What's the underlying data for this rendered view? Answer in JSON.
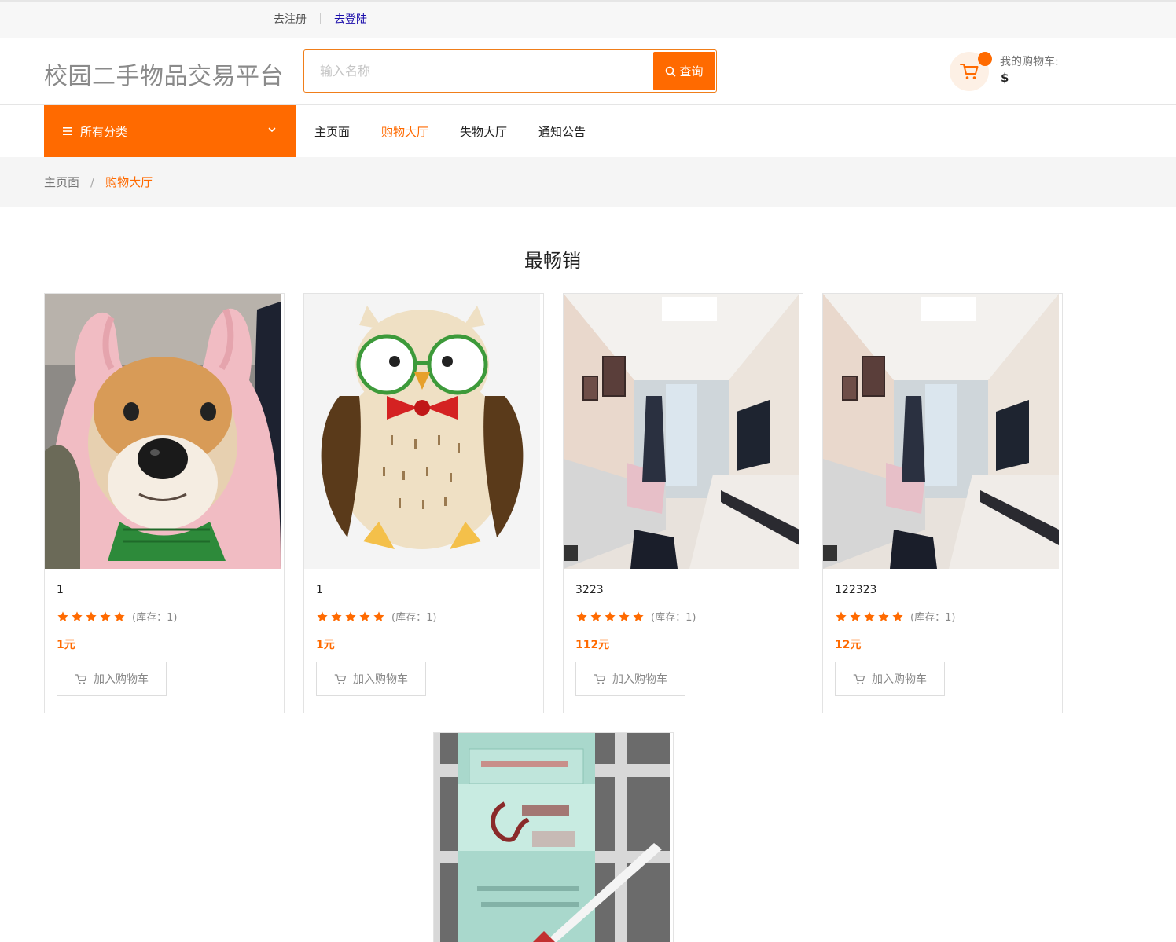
{
  "topbar": {
    "register": "去注册",
    "login": "去登陆"
  },
  "header": {
    "logo": "校园二手物品交易平台",
    "search_placeholder": "输入名称",
    "search_button": "查询",
    "cart_label": "我的购物车:",
    "cart_value": "$"
  },
  "nav": {
    "categories": "所有分类",
    "items": [
      "主页面",
      "购物大厅",
      "失物大厅",
      "通知公告"
    ],
    "active": "购物大厅"
  },
  "breadcrumb": {
    "home": "主页面",
    "separator": "/",
    "current": "购物大厅"
  },
  "section_title": "最畅销",
  "colors": {
    "accent": "#ff6a00"
  },
  "products": [
    {
      "name": "1",
      "stock": "(库存：1)",
      "price": "1元",
      "button": "加入购物车",
      "rating": 5,
      "image": "shiba-dog-in-pink-hoodie"
    },
    {
      "name": "1",
      "stock": "(库存：1)",
      "price": "1元",
      "button": "加入购物车",
      "rating": 5,
      "image": "cartoon-owl-with-glasses"
    },
    {
      "name": "3223",
      "stock": "(库存：1)",
      "price": "112元",
      "button": "加入购物车",
      "rating": 5,
      "image": "living-room"
    },
    {
      "name": "122323",
      "stock": "(库存：1)",
      "price": "12元",
      "button": "加入购物车",
      "rating": 5,
      "image": "living-room"
    },
    {
      "image": "cigarette-pack-nanjing"
    }
  ]
}
